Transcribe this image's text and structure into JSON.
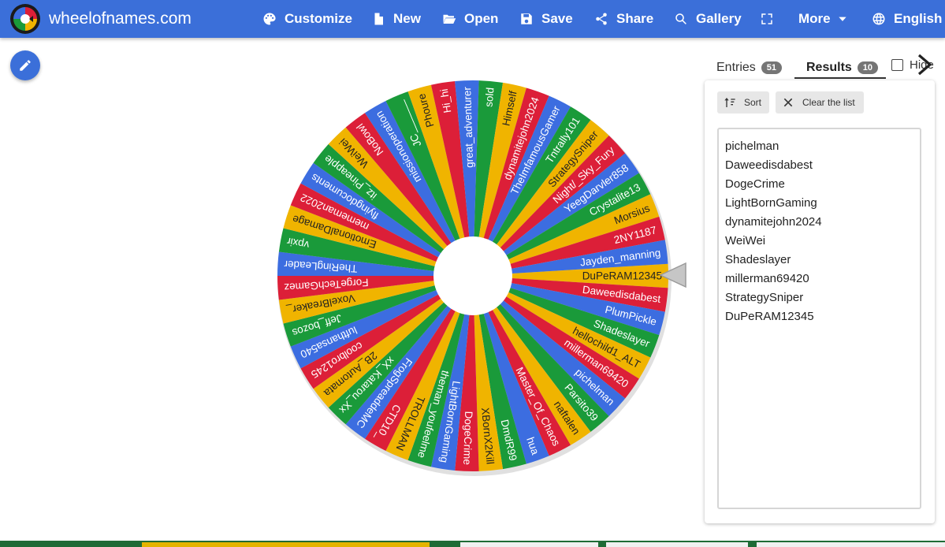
{
  "header": {
    "site_name": "wheelofnames.com",
    "nav": [
      {
        "label": "Customize",
        "icon": "palette-icon"
      },
      {
        "label": "New",
        "icon": "file-icon"
      },
      {
        "label": "Open",
        "icon": "folder-open-icon"
      },
      {
        "label": "Save",
        "icon": "save-icon"
      },
      {
        "label": "Share",
        "icon": "share-icon"
      },
      {
        "label": "Gallery",
        "icon": "search-icon"
      },
      {
        "label": "",
        "icon": "fullscreen-icon"
      },
      {
        "label": "More",
        "icon": "chevron-down-icon"
      },
      {
        "label": "English",
        "icon": "globe-icon"
      }
    ]
  },
  "tabs": {
    "entries_label": "Entries",
    "entries_count": "51",
    "results_label": "Results",
    "results_count": "10",
    "hide_label": "Hide"
  },
  "panel": {
    "sort_label": "Sort",
    "clear_label": "Clear the list",
    "results": [
      "pichelman",
      "Daweedisdabest",
      "DogeCrime",
      "LightBornGaming",
      "dynamitejohn2024",
      "WeiWei",
      "Shadeslayer",
      "millerman69420",
      "StrategySniper",
      "DuPeRAM12345"
    ]
  },
  "wheel": {
    "colors": [
      "#f0b400",
      "#dc1f38",
      "#3c6de0",
      "#1a9a3a"
    ],
    "entries": [
      "DuPeRAM12345",
      "Daweedisdabest",
      "PlumPickle",
      "Shadeslayer",
      "hellochild1_ALT",
      "millerman69420",
      "pichelman",
      "Parsito39",
      "naftalen",
      "Master_Of_Chaos",
      "hua",
      "DmdR99",
      "XBornX2Kill",
      "DogeCrime",
      "LightBornGaming",
      "theman_youfeelme",
      "TROLLMAN",
      "CTD10_",
      "FrogSpreaddeMC",
      "xX_Katarou_Xx",
      "2B_Automata",
      "coolbro1245",
      "lufthansa540",
      "Jeff_bozos",
      "VoxelBreaker_",
      "ForgeTechGamez",
      "TheRingLeader",
      "vpxir",
      "EmotionalDamage",
      "mememan2022",
      "flyingdocuments",
      "itz_Pineapple",
      "WeiWei",
      "NoBowl",
      "missionoperation",
      "JC______",
      "Phoure",
      "Hi_hi",
      "great_adventurer",
      "sold",
      "Himself",
      "dynamitejohn2024",
      "TheImfamousGamer",
      "Tntrally101",
      "StrategySniper",
      "Night/_Sky_Fury",
      "YeegDarvler858",
      "Crystalite13",
      "Morsius",
      "2NY1187",
      "Jayden_manning"
    ]
  }
}
